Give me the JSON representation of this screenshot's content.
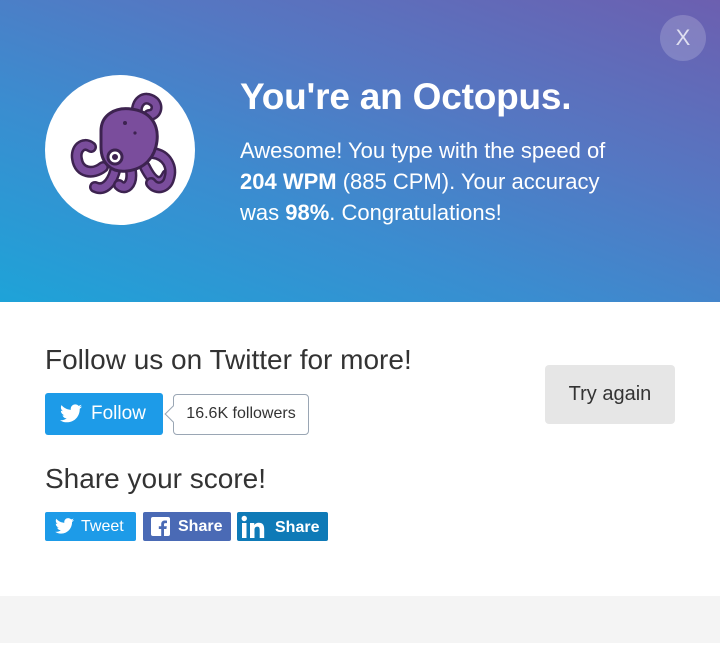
{
  "result": {
    "title": "You're an Octopus.",
    "line1": "Awesome! You type with the speed of",
    "wpm": "204 WPM",
    "cpm": " (885 CPM). Your accuracy",
    "accuracy_prefix": "was ",
    "accuracy": "98%",
    "accuracy_suffix": ". Congratulations!",
    "avatar_icon": "octopus-icon"
  },
  "close_label": "X",
  "follow": {
    "heading": "Follow us on Twitter for more!",
    "button_label": "Follow",
    "followers": "16.6K followers"
  },
  "try_again_label": "Try again",
  "share": {
    "heading": "Share your score!",
    "tweet_label": "Tweet",
    "facebook_label": "Share",
    "linkedin_label": "Share"
  },
  "colors": {
    "twitter": "#1d9be8",
    "facebook": "#4a6ab5",
    "linkedin": "#0e7ab7",
    "octopus": "#7a4d9c"
  }
}
